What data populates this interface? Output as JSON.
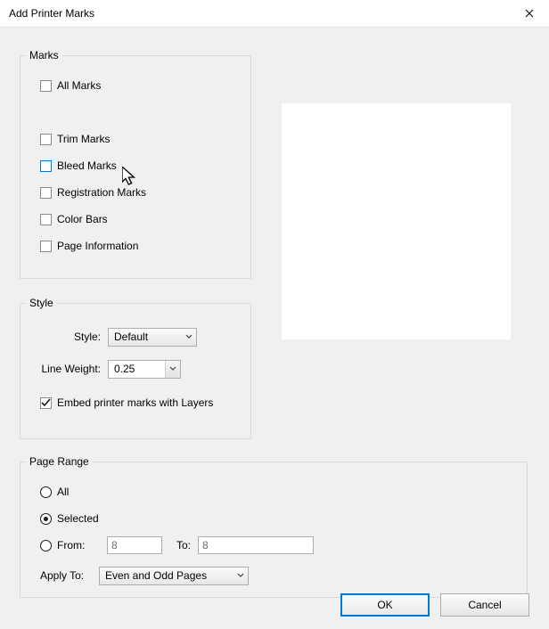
{
  "window": {
    "title": "Add Printer Marks"
  },
  "marks": {
    "legend": "Marks",
    "all": "All Marks",
    "trim": "Trim Marks",
    "bleed": "Bleed Marks",
    "registration": "Registration Marks",
    "colorbars": "Color Bars",
    "pageinfo": "Page Information"
  },
  "style": {
    "legend": "Style",
    "style_label": "Style:",
    "style_value": "Default",
    "lineweight_label": "Line Weight:",
    "lineweight_value": "0.25",
    "embed_label": "Embed printer marks with Layers"
  },
  "range": {
    "legend": "Page Range",
    "all": "All",
    "selected": "Selected",
    "from_label": "From:",
    "from_value": "8",
    "to_label": "To:",
    "to_value": "8",
    "apply_label": "Apply To:",
    "apply_value": "Even and Odd Pages"
  },
  "buttons": {
    "ok": "OK",
    "cancel": "Cancel"
  }
}
